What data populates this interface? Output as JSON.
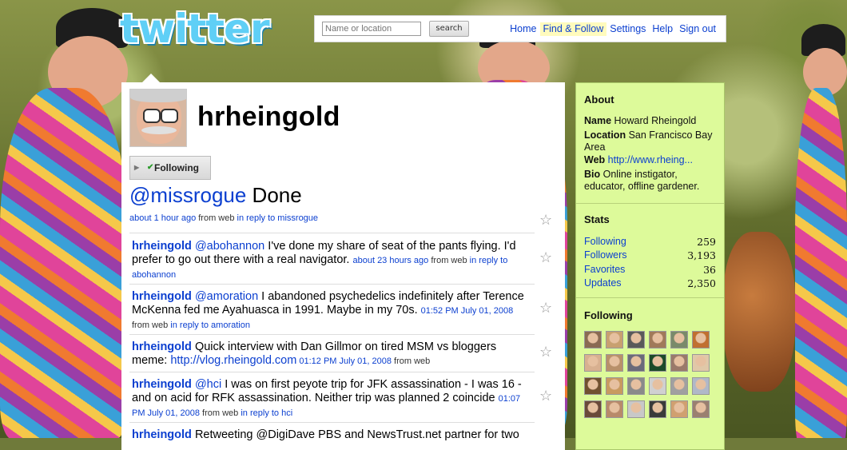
{
  "logo_text": "twitter",
  "search": {
    "placeholder": "Name or location",
    "button_label": "search"
  },
  "nav": {
    "items": [
      {
        "label": "Home"
      },
      {
        "label": "Find & Follow"
      },
      {
        "label": "Settings"
      },
      {
        "label": "Help"
      },
      {
        "label": "Sign out"
      }
    ],
    "active": "Find & Follow"
  },
  "profile": {
    "username": "hrheingold",
    "follow_button": "Following",
    "latest": {
      "mention": "@missrogue",
      "text": " Done",
      "time": "about 1 hour ago",
      "from": " from web ",
      "reply": "in reply to missrogue"
    }
  },
  "tweets": [
    {
      "author": "hrheingold",
      "mention": "@abohannon",
      "text": " I've done my share of seat of the pants flying. I'd prefer to go out there with a real navigator. ",
      "time": "about 23 hours ago",
      "from": " from web ",
      "reply": "in reply to abohannon"
    },
    {
      "author": "hrheingold",
      "mention": "@amoration",
      "text": " I abandoned psychedelics indefinitely after Terence McKenna fed me Ayahuasca in 1991. Maybe in my 70s. ",
      "time": "01:52 PM July 01, 2008",
      "from": " from web ",
      "reply": "in reply to amoration"
    },
    {
      "author": "hrheingold",
      "text": " Quick interview with Dan Gillmor on tired MSM vs bloggers meme: ",
      "link": "http://vlog.rheingold.com",
      "time": " 01:12 PM July 01, 2008",
      "from": " from web"
    },
    {
      "author": "hrheingold",
      "mention": "@hci",
      "text": " I was on first peyote trip for JFK assassination - I was 16 - and on acid for RFK assassination. Neither trip was planned 2 coincide ",
      "time": "01:07 PM July 01, 2008",
      "from": " from web ",
      "reply": "in reply to hci"
    },
    {
      "author": "hrheingold",
      "text": " Retweeting @DigiDave PBS and NewsTrust.net partner for two"
    }
  ],
  "sidebar": {
    "about_title": "About",
    "name_label": "Name",
    "name": " Howard Rheingold",
    "location_label": "Location",
    "location": " San Francisco Bay Area",
    "web_label": "Web",
    "web": "http://www.rheing...",
    "bio_label": "Bio",
    "bio": " Online instigator, educator, offline gardener.",
    "stats_title": "Stats",
    "stats": [
      {
        "label": "Following",
        "value": "259"
      },
      {
        "label": "Followers",
        "value": "3,193"
      },
      {
        "label": "Favorites",
        "value": "36"
      },
      {
        "label": "Updates",
        "value": "2,350"
      }
    ],
    "following_title": "Following"
  },
  "colors": {
    "link": "#0b3fd0",
    "sidebar_bg": "#ddfa9a",
    "sidebar_border": "#a9c86a",
    "logo": "#5fcff6",
    "nav_active_bg": "#fffbbd"
  },
  "icons": [
    "star-icon",
    "checkmark-icon",
    "dropdown-arrow-icon"
  ]
}
